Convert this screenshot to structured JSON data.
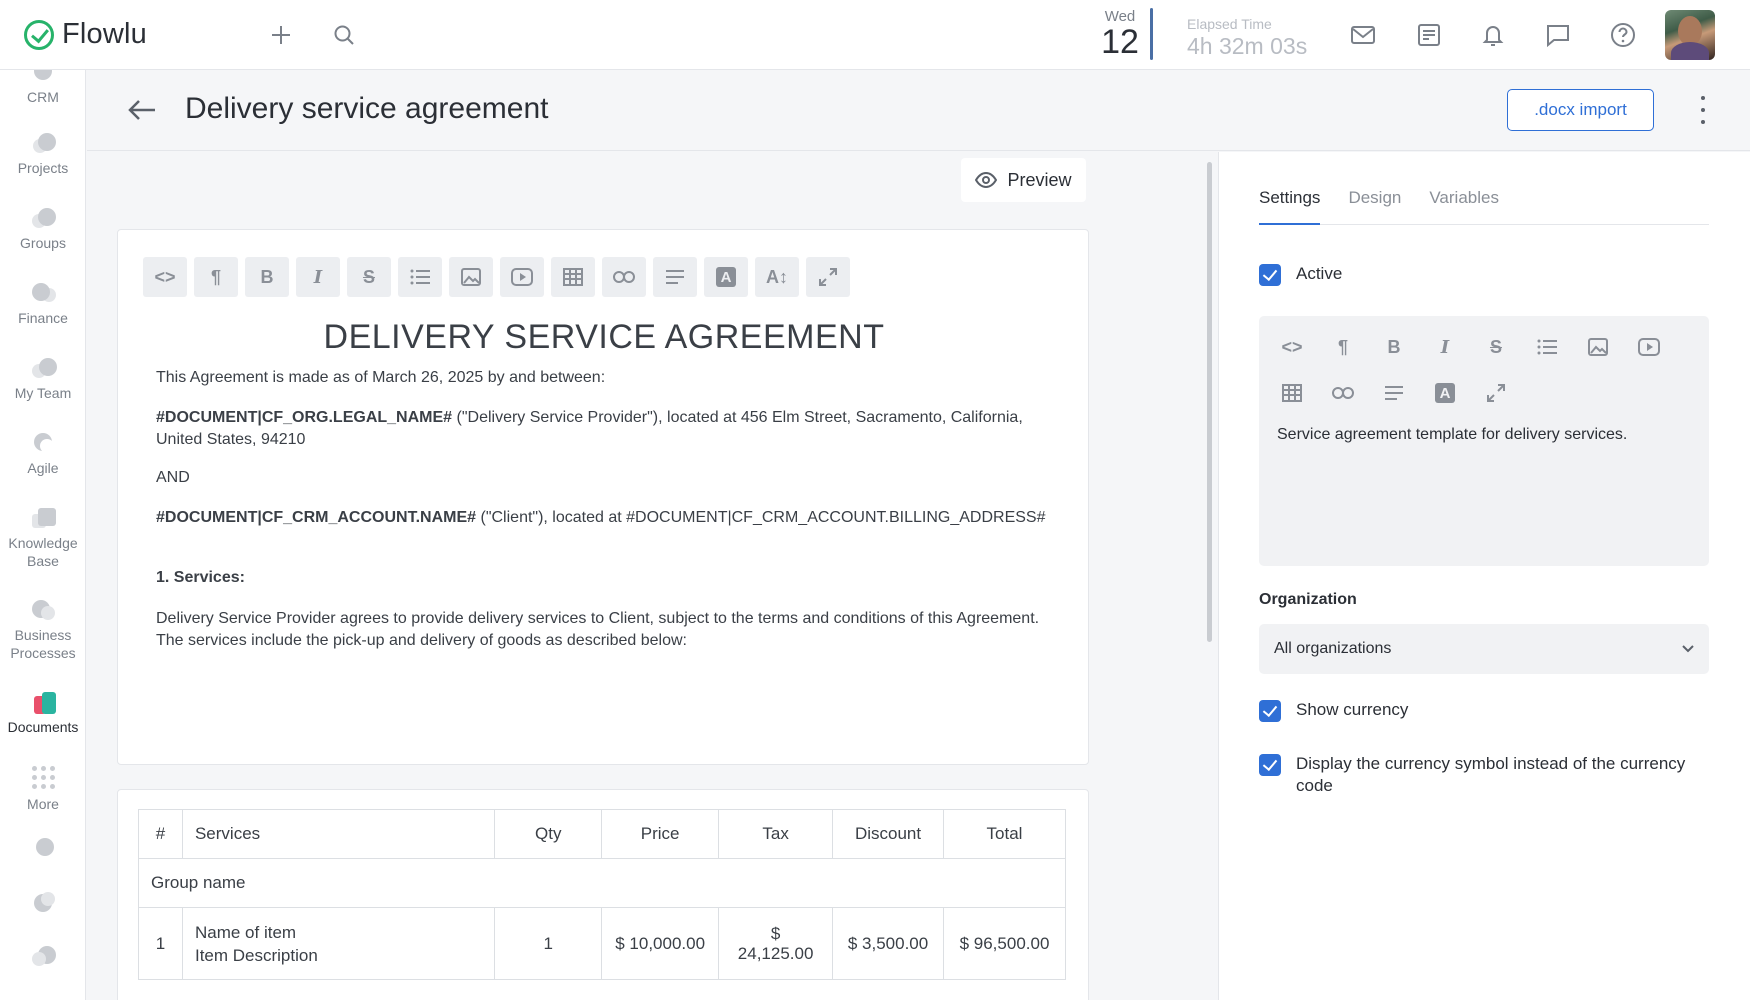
{
  "app": {
    "name": "Flowlu"
  },
  "topbar": {
    "date_dow": "Wed",
    "date_day": "12",
    "elapsed_label": "Elapsed Time",
    "elapsed_value": "4h 32m 03s"
  },
  "sidebar": {
    "items": [
      {
        "label": "CRM"
      },
      {
        "label": "Projects"
      },
      {
        "label": "Groups"
      },
      {
        "label": "Finance"
      },
      {
        "label": "My Team"
      },
      {
        "label": "Agile"
      },
      {
        "label": "Knowledge Base"
      },
      {
        "label": "Business Processes"
      },
      {
        "label": "Documents"
      },
      {
        "label": "More"
      }
    ],
    "active": "Documents"
  },
  "header": {
    "title": "Delivery service agreement",
    "import_label": ".docx import"
  },
  "editor": {
    "preview_label": "Preview",
    "heading": "DELIVERY SERVICE AGREEMENT",
    "p1": "This Agreement is made as of March 26, 2025 by and between:",
    "p2_bold": "#DOCUMENT|CF_ORG.LEGAL_NAME#",
    "p2_rest": " (\"Delivery Service Provider\"), located at 456 Elm Street, Sacramento, California, United States, 94210",
    "p3": "AND",
    "p4_bold": "#DOCUMENT|CF_CRM_ACCOUNT.NAME#",
    "p4_rest": " (\"Client\"), located at #DOCUMENT|CF_CRM_ACCOUNT.BILLING_ADDRESS#",
    "p5": "1. Services:",
    "p6": "Delivery Service Provider agrees to provide delivery services to Client, subject to the terms and conditions of this Agreement. The services include the pick-up and delivery of goods as described below:"
  },
  "table": {
    "headers": [
      "#",
      "Services",
      "Qty",
      "Price",
      "Tax",
      "Discount",
      "Total"
    ],
    "group_name": "Group name",
    "row": {
      "num": "1",
      "name": "Name of item",
      "desc": "Item Description",
      "qty": "1",
      "price": "$ 10,000.00",
      "tax": "$ 24,125.00",
      "discount": "$ 3,500.00",
      "total": "$ 96,500.00"
    }
  },
  "panel": {
    "tabs": [
      "Settings",
      "Design",
      "Variables"
    ],
    "active_tab": "Settings",
    "active_label": "Active",
    "description": "Service agreement template for delivery services.",
    "organization_label": "Organization",
    "organization_value": "All organizations",
    "show_currency_label": "Show currency",
    "currency_symbol_label": "Display the currency symbol instead of the currency code"
  },
  "colors": {
    "accent": "#2f6fd6",
    "brand_green": "#27b36a"
  }
}
